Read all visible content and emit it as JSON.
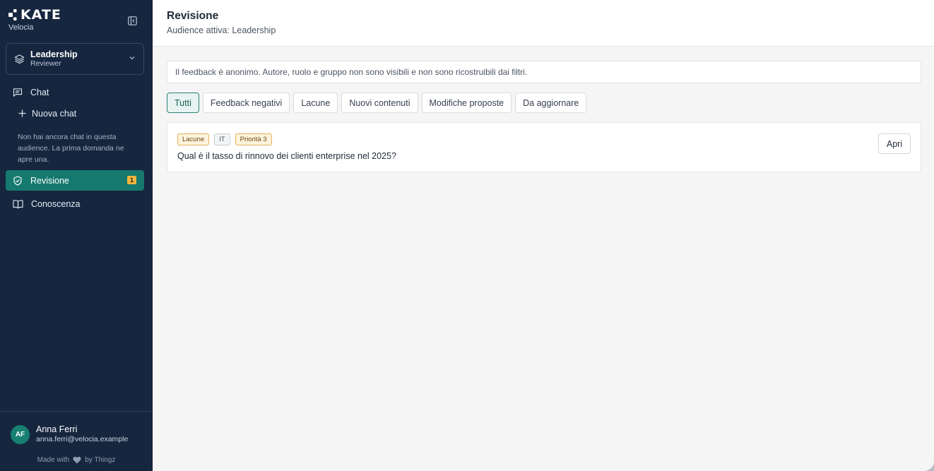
{
  "brand": {
    "name": "KATE",
    "org": "Velocia"
  },
  "audience": {
    "name": "Leadership",
    "role": "Reviewer"
  },
  "nav": {
    "chat": "Chat",
    "new_chat": "Nuova chat",
    "empty_note": "Non hai ancora chat in questa audience. La prima domanda ne apre una.",
    "review": "Revisione",
    "review_badge": "1",
    "knowledge": "Conoscenza"
  },
  "user": {
    "initials": "AF",
    "name": "Anna Ferri",
    "email": "anna.ferri@velocia.example"
  },
  "footer": {
    "made_with": "Made with",
    "by": "by Thingz"
  },
  "header": {
    "title": "Revisione",
    "subtitle": "Audience attiva: Leadership"
  },
  "notice": "Il feedback è anonimo. Autore, ruolo e gruppo non sono visibili e non sono ricostruibili dai filtri.",
  "filters": [
    {
      "label": "Tutti",
      "active": true
    },
    {
      "label": "Feedback negativi",
      "active": false
    },
    {
      "label": "Lacune",
      "active": false
    },
    {
      "label": "Nuovi contenuti",
      "active": false
    },
    {
      "label": "Modifiche proposte",
      "active": false
    },
    {
      "label": "Da aggiornare",
      "active": false
    }
  ],
  "items": [
    {
      "tags": [
        "Lacune",
        "IT",
        "Priorità 3"
      ],
      "question": "Qual è il tasso di rinnovo dei clienti enterprise nel 2025?",
      "action": "Apri"
    }
  ],
  "colors": {
    "sidebar": "#16263f",
    "accent": "#16796f",
    "badge": "#f1b73c"
  }
}
